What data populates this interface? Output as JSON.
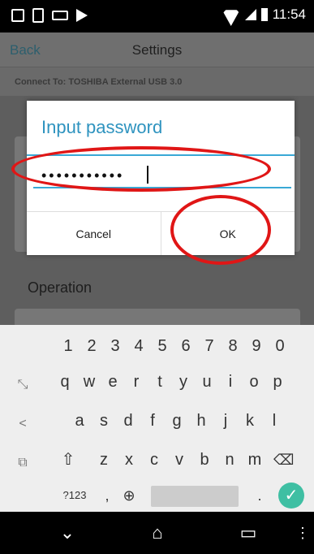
{
  "status_bar": {
    "time": "11:54"
  },
  "appbar": {
    "back": "Back",
    "title": "Settings"
  },
  "subheader": {
    "text": "Connect To: TOSHIBA  External USB 3.0"
  },
  "section": {
    "operation": "Operation"
  },
  "dialog": {
    "title": "Input password",
    "password_value": "•••••••••••",
    "cancel": "Cancel",
    "ok": "OK"
  },
  "keyboard": {
    "numbers": [
      "1",
      "2",
      "3",
      "4",
      "5",
      "6",
      "7",
      "8",
      "9",
      "0"
    ],
    "row1": [
      "q",
      "w",
      "e",
      "r",
      "t",
      "y",
      "u",
      "i",
      "o",
      "p"
    ],
    "row2": [
      "a",
      "s",
      "d",
      "f",
      "g",
      "h",
      "j",
      "k",
      "l"
    ],
    "row3": [
      "z",
      "x",
      "c",
      "v",
      "b",
      "n",
      "m"
    ],
    "mode_key": "?123",
    "comma": ",",
    "period": "."
  },
  "colors": {
    "accent": "#2e93bf",
    "annotation": "#e01616",
    "enter": "#3fbfa3"
  }
}
